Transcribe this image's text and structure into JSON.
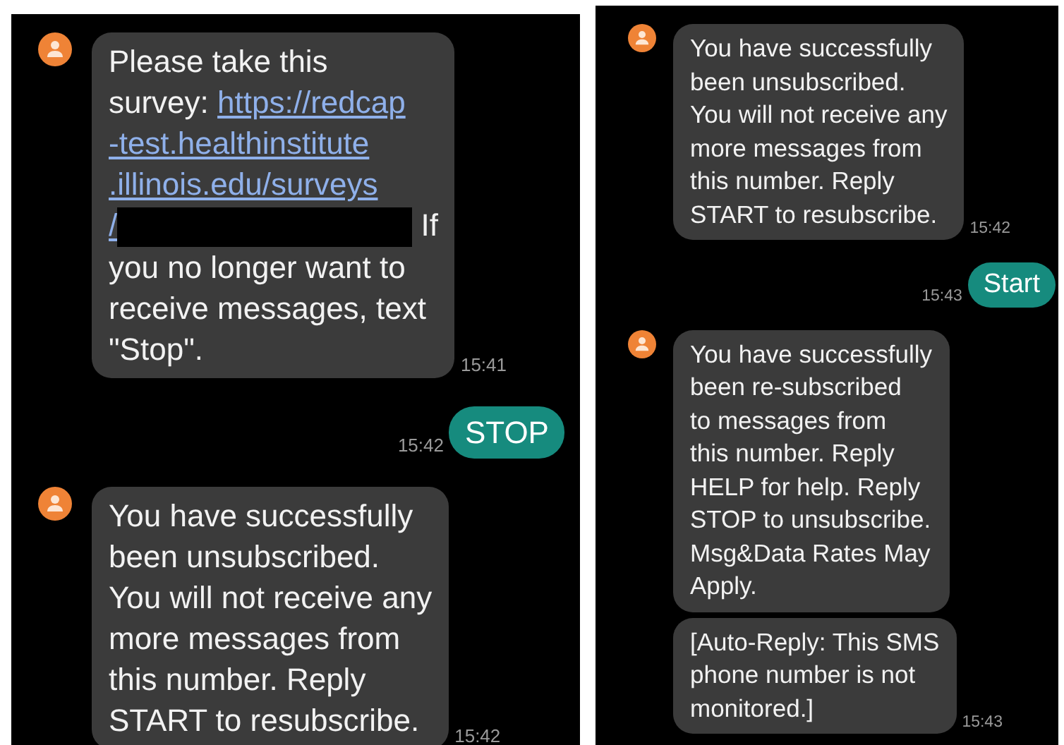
{
  "panels": [
    {
      "messages": [
        {
          "kind": "incoming",
          "show_avatar": true,
          "time": "15:41",
          "lines": [
            [
              {
                "kind": "text",
                "text": "Please take this"
              }
            ],
            [
              {
                "kind": "text",
                "text": "survey: "
              },
              {
                "kind": "link",
                "text": "https://redcap"
              }
            ],
            [
              {
                "kind": "link",
                "text": "-test.healthinstitute"
              }
            ],
            [
              {
                "kind": "link",
                "text": ".illinois.edu/surveys"
              }
            ],
            [
              {
                "kind": "link",
                "text": "/"
              },
              {
                "kind": "redacted"
              },
              {
                "kind": "text",
                "text": " If"
              }
            ],
            [
              {
                "kind": "text",
                "text": "you no longer want to"
              }
            ],
            [
              {
                "kind": "text",
                "text": "receive messages, text"
              }
            ],
            [
              {
                "kind": "text",
                "text": "\"Stop\"."
              }
            ]
          ]
        },
        {
          "kind": "outgoing",
          "time": "15:42",
          "lines": [
            [
              {
                "kind": "text",
                "text": "STOP"
              }
            ]
          ]
        },
        {
          "kind": "incoming",
          "show_avatar": true,
          "time": "15:42",
          "lines": [
            [
              {
                "kind": "text",
                "text": "You have successfully"
              }
            ],
            [
              {
                "kind": "text",
                "text": "been unsubscribed."
              }
            ],
            [
              {
                "kind": "text",
                "text": "You will not receive any"
              }
            ],
            [
              {
                "kind": "text",
                "text": "more messages from"
              }
            ],
            [
              {
                "kind": "text",
                "text": "this number. Reply"
              }
            ],
            [
              {
                "kind": "text",
                "text": "START to resubscribe."
              }
            ]
          ]
        }
      ]
    },
    {
      "messages": [
        {
          "kind": "incoming",
          "show_avatar": true,
          "time": "15:42",
          "lines": [
            [
              {
                "kind": "text",
                "text": "You have successfully"
              }
            ],
            [
              {
                "kind": "text",
                "text": "been unsubscribed."
              }
            ],
            [
              {
                "kind": "text",
                "text": "You will not receive any"
              }
            ],
            [
              {
                "kind": "text",
                "text": "more messages from"
              }
            ],
            [
              {
                "kind": "text",
                "text": "this number. Reply"
              }
            ],
            [
              {
                "kind": "text",
                "text": "START to resubscribe."
              }
            ]
          ]
        },
        {
          "kind": "outgoing",
          "time": "15:43",
          "lines": [
            [
              {
                "kind": "text",
                "text": "Start"
              }
            ]
          ]
        },
        {
          "kind": "incoming",
          "show_avatar": true,
          "lines": [
            [
              {
                "kind": "text",
                "text": "You have successfully"
              }
            ],
            [
              {
                "kind": "text",
                "text": "been re-subscribed"
              }
            ],
            [
              {
                "kind": "text",
                "text": "to messages from"
              }
            ],
            [
              {
                "kind": "text",
                "text": "this number. Reply"
              }
            ],
            [
              {
                "kind": "text",
                "text": "HELP for help. Reply"
              }
            ],
            [
              {
                "kind": "text",
                "text": "STOP to unsubscribe."
              }
            ],
            [
              {
                "kind": "text",
                "text": "Msg&Data Rates May"
              }
            ],
            [
              {
                "kind": "text",
                "text": "Apply."
              }
            ]
          ]
        },
        {
          "kind": "incoming",
          "show_avatar": false,
          "time": "15:43",
          "lines": [
            [
              {
                "kind": "text",
                "text": "[Auto-Reply: This SMS"
              }
            ],
            [
              {
                "kind": "text",
                "text": "phone number is not"
              }
            ],
            [
              {
                "kind": "text",
                "text": "monitored.]"
              }
            ]
          ]
        }
      ]
    }
  ]
}
